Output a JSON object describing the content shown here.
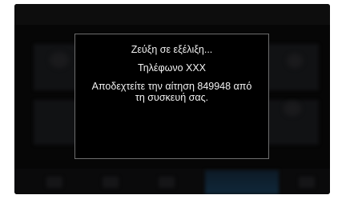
{
  "dialog": {
    "title": "Ζεύξη σε εξέλιξη...",
    "device": "Τηλέφωνο XXX",
    "message_line1": "Αποδεχτείτε την αίτηση 849948 από",
    "message_line2": "τη συσκευή σας."
  },
  "colors": {
    "screen_background": "#060606",
    "dialog_background": "#000000",
    "dialog_border": "#6e6e6e",
    "text": "#f2f2f2"
  }
}
